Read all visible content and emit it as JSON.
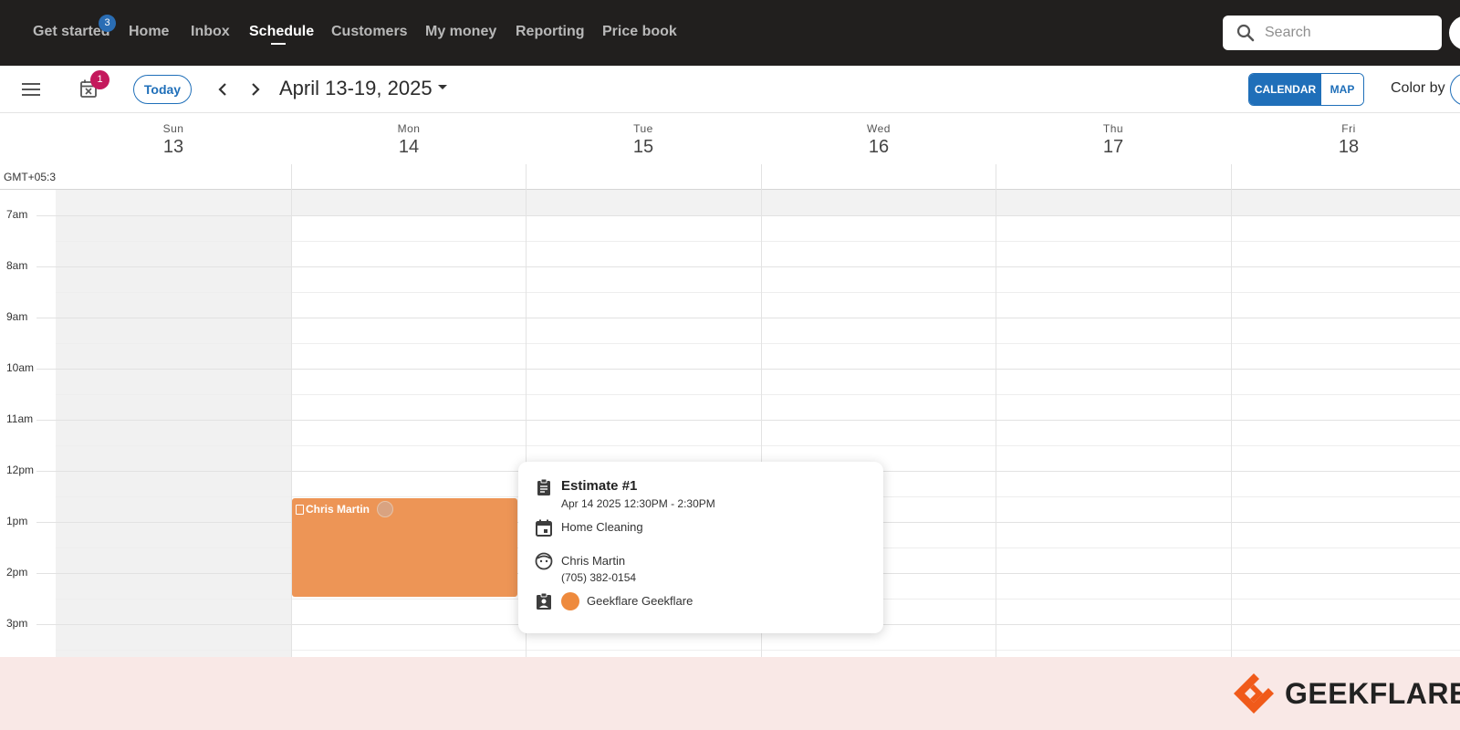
{
  "nav": {
    "items": [
      {
        "label": "Get started",
        "badge": "3"
      },
      {
        "label": "Home"
      },
      {
        "label": "Inbox"
      },
      {
        "label": "Schedule",
        "active": true
      },
      {
        "label": "Customers"
      },
      {
        "label": "My money"
      },
      {
        "label": "Reporting"
      },
      {
        "label": "Price book"
      }
    ],
    "search_placeholder": "Search"
  },
  "toolbar": {
    "unscheduled_badge": "1",
    "today_label": "Today",
    "date_range": "April 13-19, 2025",
    "view_calendar": "CALENDAR",
    "view_map": "MAP",
    "color_by_label": "Color by"
  },
  "calendar": {
    "timezone": "GMT+05:3",
    "days": [
      {
        "name": "Sun",
        "date": "13"
      },
      {
        "name": "Mon",
        "date": "14"
      },
      {
        "name": "Tue",
        "date": "15"
      },
      {
        "name": "Wed",
        "date": "16"
      },
      {
        "name": "Thu",
        "date": "17"
      },
      {
        "name": "Fri",
        "date": "18"
      }
    ],
    "hours": [
      "7am",
      "8am",
      "9am",
      "10am",
      "11am",
      "12pm",
      "1pm",
      "2pm",
      "3pm"
    ],
    "event": {
      "title": "Chris Martin",
      "color": "#ed9556"
    }
  },
  "popover": {
    "title": "Estimate #1",
    "datetime": "Apr 14 2025 12:30PM - 2:30PM",
    "service": "Home Cleaning",
    "customer_name": "Chris Martin",
    "customer_phone": "(705) 382-0154",
    "assignee": "Geekflare Geekflare"
  },
  "footer": {
    "brand": "GEEKFLARE",
    "brand_color": "#f05a1a"
  },
  "colors": {
    "topbar": "#211f1e",
    "accent": "#1f6fb9",
    "badge_red": "#c4185c"
  }
}
